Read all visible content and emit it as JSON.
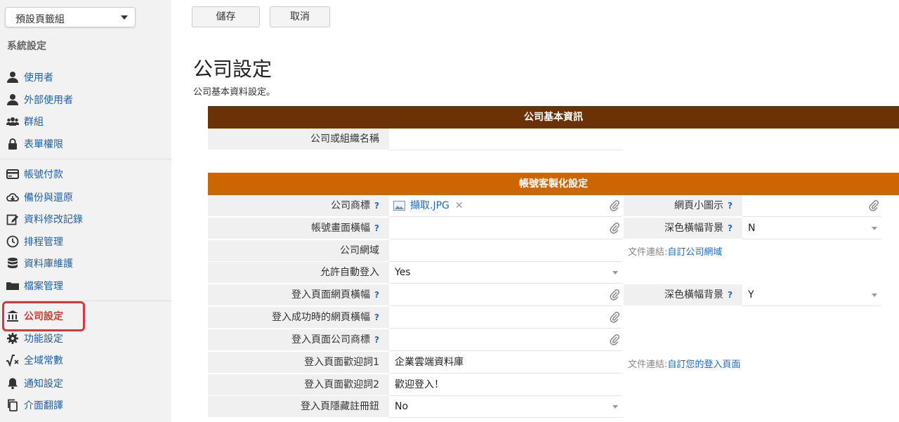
{
  "sidebar": {
    "tab_select": "預設頁籤組",
    "heading": "系統設定",
    "items": [
      {
        "label": "使用者",
        "icon": "user-icon"
      },
      {
        "label": "外部使用者",
        "icon": "user-icon"
      },
      {
        "label": "群組",
        "icon": "users-icon"
      },
      {
        "label": "表單權限",
        "icon": "lock-icon"
      },
      {
        "label": "帳號付款",
        "icon": "credit-card-icon"
      },
      {
        "label": "備份與還原",
        "icon": "cloud-download-icon"
      },
      {
        "label": "資料修改記錄",
        "icon": "edit-icon"
      },
      {
        "label": "排程管理",
        "icon": "clock-icon"
      },
      {
        "label": "資料庫維護",
        "icon": "database-icon"
      },
      {
        "label": "檔案管理",
        "icon": "folder-icon"
      },
      {
        "label": "公司設定",
        "icon": "bank-icon"
      },
      {
        "label": "功能設定",
        "icon": "gear-icon"
      },
      {
        "label": "全域常數",
        "icon": "sqrt-icon"
      },
      {
        "label": "通知設定",
        "icon": "bell-icon"
      },
      {
        "label": "介面翻譯",
        "icon": "copy-icon"
      }
    ]
  },
  "toolbar": {
    "save": "儲存",
    "cancel": "取消"
  },
  "page": {
    "title": "公司設定",
    "subtitle": "公司基本資料設定。"
  },
  "sections": {
    "basic": {
      "title": "公司基本資訊",
      "color": "#6b3205"
    },
    "custom": {
      "title": "帳號客製化設定",
      "color": "#cc6600"
    }
  },
  "fields": {
    "company_name": "公司或組織名稱",
    "logo": "公司商標",
    "logo_file": "擷取.JPG",
    "favicon": "網頁小圖示",
    "banner": "帳號畫面橫幅",
    "dark_banner_bg": "深色橫幅背景",
    "dark_banner_bg_value": "N",
    "domain": "公司網域",
    "auto_login": "允許自動登入",
    "auto_login_value": "Yes",
    "login_banner": "登入頁面網頁橫幅",
    "dark_bg": "深色橫幅背景",
    "dark_bg_value": "Y",
    "success_banner": "登入成功時的網頁橫幅",
    "login_logo": "登入頁面公司商標",
    "welcome1": "登入頁面歡迎詞1",
    "welcome1_value": "企業雲端資料庫",
    "welcome2": "登入頁面歡迎詞2",
    "welcome2_value": "歡迎登入！",
    "hide_register": "登入頁隱藏註冊鈕",
    "hide_register_value": "No"
  },
  "doc_links": {
    "prefix": "文件連結:",
    "domain_link": "自訂公司網域",
    "login_link": "自訂您的登入頁面"
  },
  "help_mark": "?"
}
